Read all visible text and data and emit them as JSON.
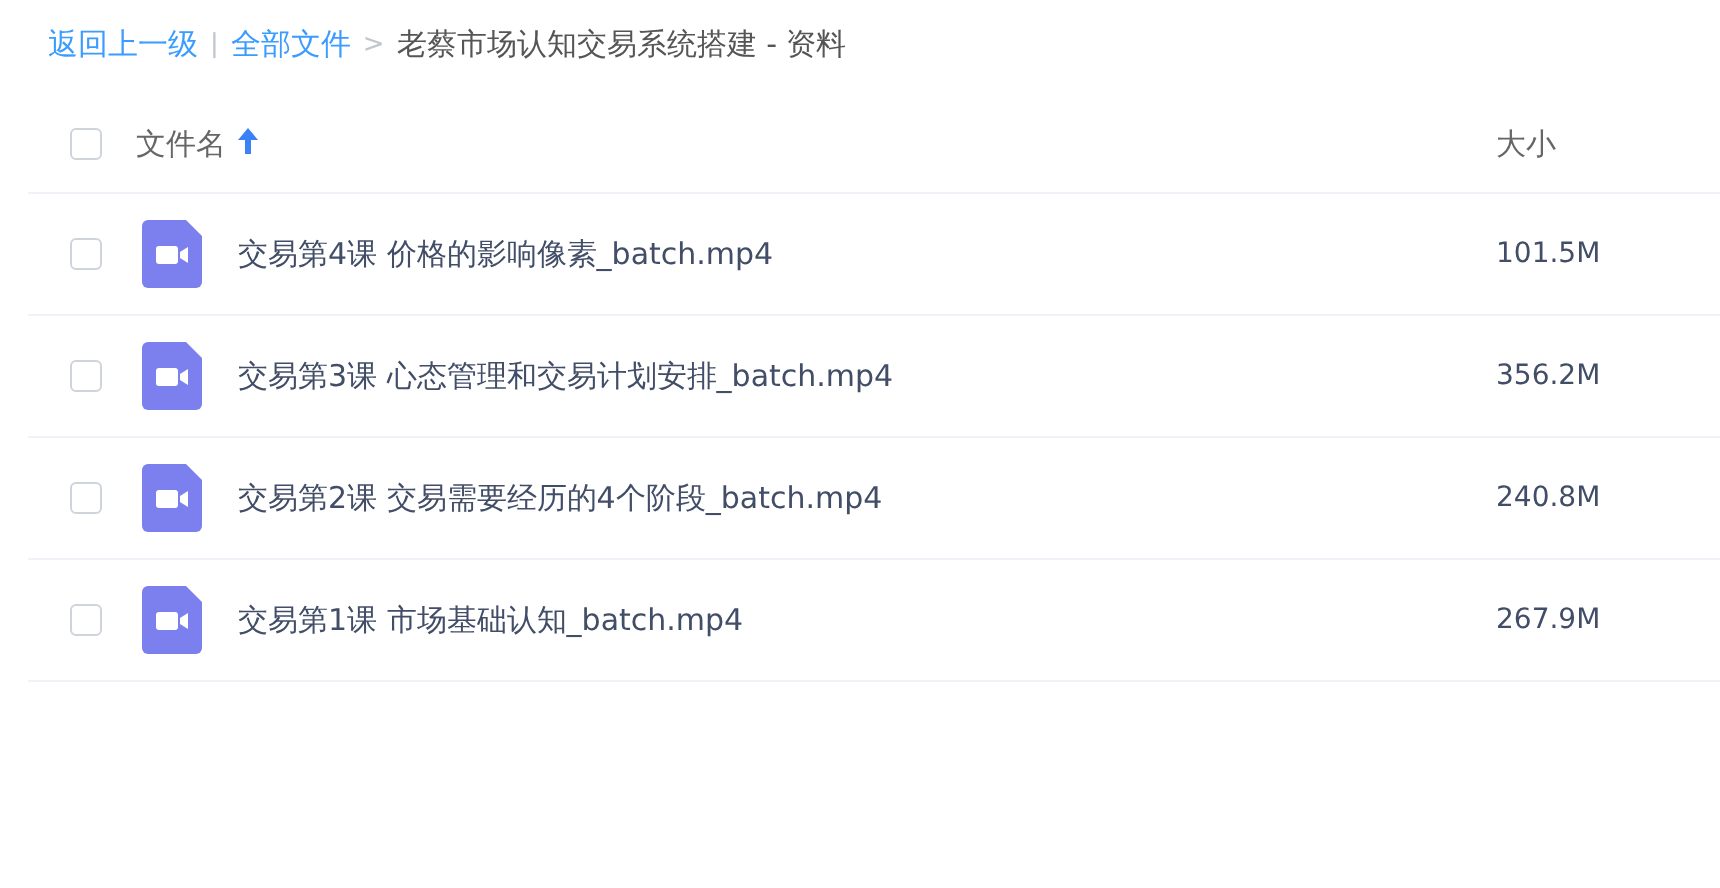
{
  "breadcrumb": {
    "back_link": "返回上一级",
    "divider": "|",
    "root_link": "全部文件",
    "arrow": ">",
    "current": "老蔡市场认知交易系统搭建 - 资料"
  },
  "table": {
    "header": {
      "checked": false,
      "columns": [
        {
          "label": "文件名",
          "sorted": true
        },
        {
          "label": "大小",
          "sorted": false
        }
      ]
    },
    "rows": [
      {
        "checked": false,
        "kind": "video",
        "name": "交易第4课 价格的影响像素_batch.mp4",
        "size": "101.5M"
      },
      {
        "checked": false,
        "kind": "video",
        "name": "交易第3课 心态管理和交易计划安排_batch.mp4",
        "size": "356.2M"
      },
      {
        "checked": false,
        "kind": "video",
        "name": "交易第2课 交易需要经历的4个阶段_batch.mp4",
        "size": "240.8M"
      },
      {
        "checked": false,
        "kind": "video",
        "name": "交易第1课 市场基础认知_batch.mp4",
        "size": "267.9M"
      }
    ]
  }
}
